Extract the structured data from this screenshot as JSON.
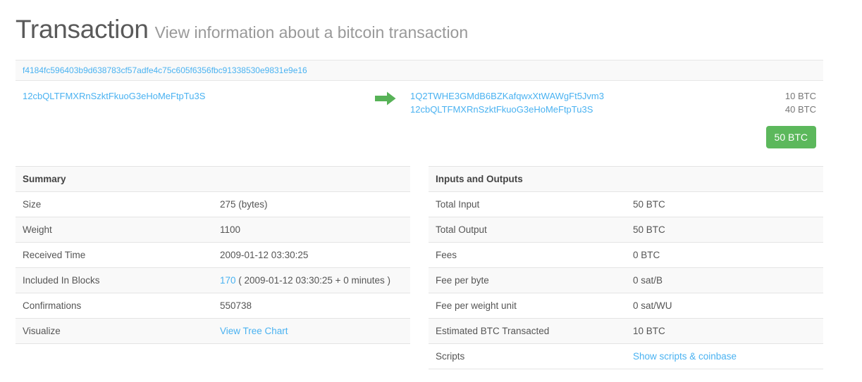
{
  "header": {
    "title": "Transaction",
    "subtitle": "View information about a bitcoin transaction"
  },
  "transaction": {
    "hash": "f4184fc596403b9d638783cf57adfe4c75c605f6356fbc91338530e9831e9e16",
    "arrow_icon": "arrow-right-icon",
    "arrow_color": "#5cb85c",
    "inputs": [
      {
        "address": "12cbQLTFMXRnSzktFkuoG3eHoMeFtpTu3S"
      }
    ],
    "outputs": [
      {
        "address": "1Q2TWHE3GMdB6BZKafqwxXtWAWgFt5Jvm3",
        "amount": "10 BTC"
      },
      {
        "address": "12cbQLTFMXRnSzktFkuoG3eHoMeFtpTu3S",
        "amount": "40 BTC"
      }
    ],
    "total_badge": "50 BTC",
    "badge_color": "#5cb85c",
    "link_color": "#4ab2f1"
  },
  "summary": {
    "title": "Summary",
    "rows": [
      {
        "label": "Size",
        "value": "275 (bytes)"
      },
      {
        "label": "Weight",
        "value": "1100"
      },
      {
        "label": "Received Time",
        "value": "2009-01-12 03:30:25"
      },
      {
        "label": "Included In Blocks",
        "value": "170",
        "link": true,
        "suffix": " ( 2009-01-12 03:30:25 + 0 minutes )"
      },
      {
        "label": "Confirmations",
        "value": "550738"
      },
      {
        "label": "Visualize",
        "value": "View Tree Chart",
        "link": true
      }
    ]
  },
  "inputs_outputs": {
    "title": "Inputs and Outputs",
    "rows": [
      {
        "label": "Total Input",
        "value": "50 BTC"
      },
      {
        "label": "Total Output",
        "value": "50 BTC"
      },
      {
        "label": "Fees",
        "value": "0 BTC"
      },
      {
        "label": "Fee per byte",
        "value": "0 sat/B"
      },
      {
        "label": "Fee per weight unit",
        "value": "0 sat/WU"
      },
      {
        "label": "Estimated BTC Transacted",
        "value": "10 BTC"
      },
      {
        "label": "Scripts",
        "value": "Show scripts & coinbase",
        "link": true
      }
    ]
  }
}
